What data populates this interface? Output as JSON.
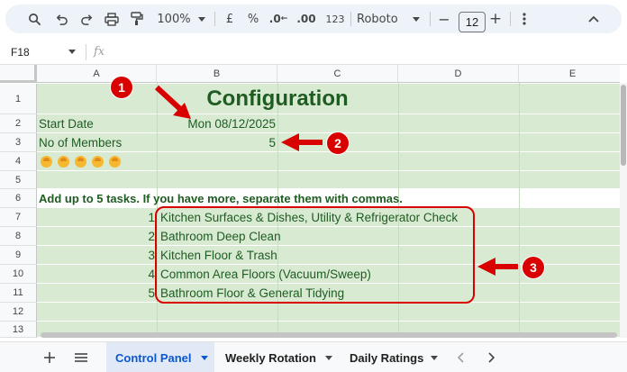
{
  "toolbar": {
    "zoom": "100%",
    "currency": "£",
    "percent": "%",
    "decrease_decimal": ".0",
    "increase_decimal": ".00",
    "number_format": "123",
    "font": "Roboto",
    "minus": "−",
    "font_size": "12",
    "plus": "+"
  },
  "formula_bar": {
    "cell_ref": "F18",
    "fx": "fx"
  },
  "columns": [
    "A",
    "B",
    "C",
    "D",
    "E"
  ],
  "rows": [
    "1",
    "2",
    "3",
    "4",
    "5",
    "6",
    "7",
    "8",
    "9",
    "10",
    "11",
    "12",
    "13"
  ],
  "sheet": {
    "title": "Configuration",
    "start_date_label": "Start Date",
    "start_date_value": "Mon 08/12/2025",
    "members_label": "No of Members",
    "members_value": "5",
    "task_instruction": "Add up to 5 tasks. If you have more, separate them with commas.",
    "tasks": [
      {
        "num": "1",
        "text": "Kitchen Surfaces & Dishes, Utility & Refrigerator Check"
      },
      {
        "num": "2",
        "text": "Bathroom Deep Clean"
      },
      {
        "num": "3",
        "text": "Kitchen Floor & Trash"
      },
      {
        "num": "4",
        "text": "Common Area Floors (Vacuum/Sweep)"
      },
      {
        "num": "5",
        "text": "Bathroom Floor & General Tidying"
      }
    ]
  },
  "annotations": {
    "c1": "1",
    "c2": "2",
    "c3": "3"
  },
  "tabs": [
    {
      "label": "Control Panel",
      "active": true
    },
    {
      "label": "Weekly Rotation",
      "active": false
    },
    {
      "label": "Daily Ratings",
      "active": false
    }
  ],
  "colors": {
    "green_fill": "#d9ead3",
    "green_text": "#1e5c22",
    "annotation_red": "#d90000",
    "active_tab": "#0b57d0"
  }
}
